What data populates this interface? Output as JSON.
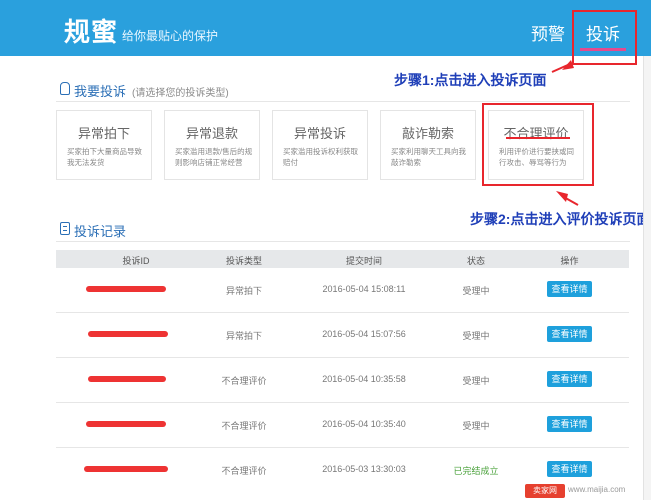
{
  "header": {
    "brand": "规蜜",
    "slogan": "给你最贴心的保护",
    "nav": {
      "warn": "预警",
      "complain": "投诉"
    }
  },
  "annotations": {
    "step1": "步骤1:点击进入投诉页面",
    "step2": "步骤2:点击进入评价投诉页面"
  },
  "complain_section": {
    "title": "我要投诉",
    "hint": "(请选择您的投诉类型)",
    "cards": [
      {
        "title": "异常拍下",
        "desc": "买家拍下大量商品导致我无法发货"
      },
      {
        "title": "异常退款",
        "desc": "买家滥用退款/售后的规则影响店铺正常经营"
      },
      {
        "title": "异常投诉",
        "desc": "买家滥用投诉权利获取赔付"
      },
      {
        "title": "敲诈勒索",
        "desc": "买家利用聊天工具向我敲诈勒索"
      },
      {
        "title": "不合理评价",
        "desc": "利用评价进行要挟或同行攻击、辱骂等行为"
      }
    ]
  },
  "records_section": {
    "title": "投诉记录",
    "columns": [
      "投诉ID",
      "投诉类型",
      "提交时间",
      "状态",
      "操作"
    ],
    "rows": [
      {
        "type": "异常拍下",
        "time": "2016-05-04 15:08:11",
        "status": "受理中",
        "action": "查看详情"
      },
      {
        "type": "异常拍下",
        "time": "2016-05-04 15:07:56",
        "status": "受理中",
        "action": "查看详情"
      },
      {
        "type": "不合理评价",
        "time": "2016-05-04 10:35:58",
        "status": "受理中",
        "action": "查看详情"
      },
      {
        "type": "不合理评价",
        "time": "2016-05-04 10:35:40",
        "status": "受理中",
        "action": "查看详情"
      },
      {
        "type": "不合理评价",
        "time": "2016-05-03 13:30:03",
        "status": "已完结成立",
        "action": "查看详情"
      }
    ]
  },
  "watermark": {
    "badge": "卖家网",
    "url": "www.maijia.com"
  },
  "colors": {
    "header": "#2aa0dd",
    "highlight": "#e8262d",
    "annotation": "#1f3fb8",
    "button": "#1ea0dc"
  }
}
